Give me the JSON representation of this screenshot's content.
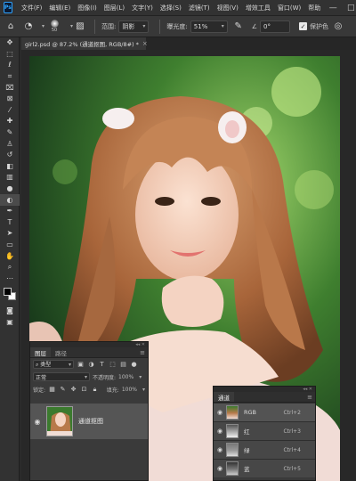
{
  "app": {
    "logo_text": "Ps"
  },
  "menu": [
    "文件(F)",
    "编辑(E)",
    "图像(I)",
    "图层(L)",
    "文字(Y)",
    "选择(S)",
    "滤镜(T)",
    "视图(V)",
    "增效工具",
    "窗口(W)",
    "帮助"
  ],
  "window_controls": {
    "minimize": "—",
    "maximize": "□",
    "close": "✕"
  },
  "options": {
    "brush_size": "50",
    "range_label": "范围:",
    "range_value": "阴影",
    "exposure_label": "曝光度:",
    "exposure_value": "51%",
    "angle_icon": "∠",
    "angle_value": "0°",
    "protect_tones_label": "保护色",
    "protect_tones_checked": true
  },
  "document": {
    "tab_title": "girl2.psd @ 87.2% (通道抠图, RGB/8#) *",
    "close": "×"
  },
  "tools": [
    "move-tool",
    "marquee-tool",
    "lasso-tool",
    "quick-select-tool",
    "crop-tool",
    "frame-tool",
    "eyedropper-tool",
    "spot-healing-tool",
    "brush-tool",
    "clone-stamp-tool",
    "history-brush-tool",
    "eraser-tool",
    "gradient-tool",
    "blur-tool",
    "burn-tool",
    "pen-tool",
    "type-tool",
    "path-select-tool",
    "rectangle-tool",
    "hand-tool",
    "zoom-tool",
    "edit-toolbar"
  ],
  "layers_panel": {
    "tabs": [
      "图层",
      "路径"
    ],
    "filter_label": "类型",
    "blend_mode": "正常",
    "opacity_label": "不透明度:",
    "opacity_value": "100%",
    "lock_label": "锁定:",
    "fill_label": "填充:",
    "fill_value": "100%",
    "layer_name": "通道抠图"
  },
  "channels_panel": {
    "title": "通道",
    "channels": [
      {
        "name": "RGB",
        "shortcut": "Ctrl+2"
      },
      {
        "name": "红",
        "shortcut": "Ctrl+3"
      },
      {
        "name": "绿",
        "shortcut": "Ctrl+4"
      },
      {
        "name": "蓝",
        "shortcut": "Ctrl+5"
      }
    ]
  },
  "colors": {
    "foreground": "#000000",
    "background": "#ffffff",
    "accent": "#31a8ff"
  }
}
